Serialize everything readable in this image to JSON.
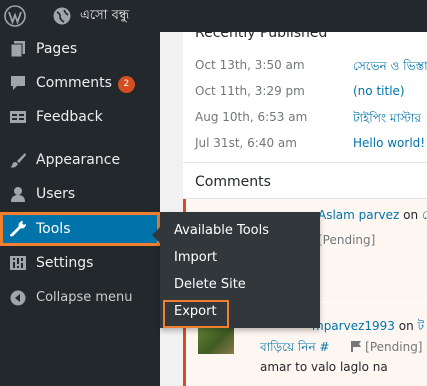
{
  "adminbar": {
    "site_name": "এসো বন্ধু"
  },
  "sidebar": {
    "items": [
      {
        "label": "Pages"
      },
      {
        "label": "Comments",
        "badge": "2"
      },
      {
        "label": "Feedback"
      },
      {
        "label": "Appearance"
      },
      {
        "label": "Users"
      },
      {
        "label": "Tools"
      },
      {
        "label": "Settings"
      }
    ],
    "collapse_label": "Collapse menu"
  },
  "tools_submenu": {
    "items": [
      "Available Tools",
      "Import",
      "Delete Site",
      "Export"
    ]
  },
  "recently_published": {
    "heading": "Recently Published",
    "rows": [
      {
        "date": "Oct 13th, 3:50 am",
        "title": "সেভেন ও ভিস্তা"
      },
      {
        "date": "Oct 11th, 3:29 pm",
        "title": "(no title)"
      },
      {
        "date": "Aug 10th, 6:53 am",
        "title": "টাইপিং মাস্টার"
      },
      {
        "date": "Jul 31st, 6:40 am",
        "title": "Hello world!"
      }
    ]
  },
  "comments": {
    "heading": "Comments",
    "items": [
      {
        "author": "Aslam parvez",
        "on_word": "on",
        "post": "সে",
        "status": "[Pending]"
      },
      {
        "author": "mparvez1993",
        "on_word": "on",
        "post": "ট",
        "post_title_line": "বাড়িয়ে নিন #",
        "status": "[Pending]",
        "text": "amar to valo laglo na"
      }
    ]
  },
  "colors": {
    "accent": "#f0802f",
    "sidebar_bg": "#23282d",
    "link": "#0073aa",
    "active_bg": "#0073aa"
  }
}
